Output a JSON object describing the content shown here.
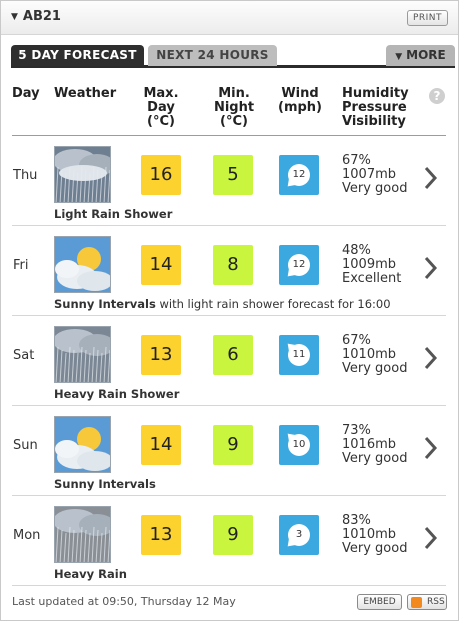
{
  "header": {
    "location": "AB21",
    "print_label": "PRINT"
  },
  "tabs": {
    "active": "5 DAY FORECAST",
    "inactive": "NEXT 24 HOURS",
    "more": "MORE"
  },
  "columns": {
    "day": "Day",
    "weather": "Weather",
    "max": [
      "Max.",
      "Day",
      "(°C)"
    ],
    "min": [
      "Min.",
      "Night",
      "(°C)"
    ],
    "wind": [
      "Wind",
      "(mph)"
    ],
    "stats": [
      "Humidity",
      "Pressure",
      "Visibility"
    ],
    "help": "?"
  },
  "rows": [
    {
      "day": "Thu",
      "icon": "light-rain-shower-icon",
      "desc_bold": "Light Rain Shower",
      "desc_extra": "",
      "max": "16",
      "min": "5",
      "wind": "12",
      "wind_dir": "from south-west",
      "humidity": "67%",
      "pressure": "1007mb",
      "visibility": "Very good"
    },
    {
      "day": "Fri",
      "icon": "sunny-intervals-icon",
      "desc_bold": "Sunny Intervals",
      "desc_extra": " with light rain shower forecast for 16:00",
      "max": "14",
      "min": "8",
      "wind": "12",
      "wind_dir": "from south-west",
      "humidity": "48%",
      "pressure": "1009mb",
      "visibility": "Excellent"
    },
    {
      "day": "Sat",
      "icon": "heavy-rain-shower-icon",
      "desc_bold": "Heavy Rain Shower",
      "desc_extra": "",
      "max": "13",
      "min": "6",
      "wind": "11",
      "wind_dir": "from north-west",
      "humidity": "67%",
      "pressure": "1010mb",
      "visibility": "Very good"
    },
    {
      "day": "Sun",
      "icon": "sunny-intervals-icon",
      "desc_bold": "Sunny Intervals",
      "desc_extra": "",
      "max": "14",
      "min": "9",
      "wind": "10",
      "wind_dir": "from north-west",
      "humidity": "73%",
      "pressure": "1016mb",
      "visibility": "Very good"
    },
    {
      "day": "Mon",
      "icon": "heavy-rain-icon",
      "desc_bold": "Heavy Rain",
      "desc_extra": "",
      "max": "13",
      "min": "9",
      "wind": "3",
      "wind_dir": "from south-west",
      "humidity": "83%",
      "pressure": "1010mb",
      "visibility": "Very good"
    }
  ],
  "footer": {
    "updated": "Last updated at 09:50, Thursday 12 May",
    "embed": "EMBED",
    "rss": "RSS"
  },
  "colors": {
    "max_temp": "#fcd22f",
    "min_temp": "#c9f53f",
    "wind": "#3ba8e0",
    "active_tab": "#2e2e2e"
  }
}
